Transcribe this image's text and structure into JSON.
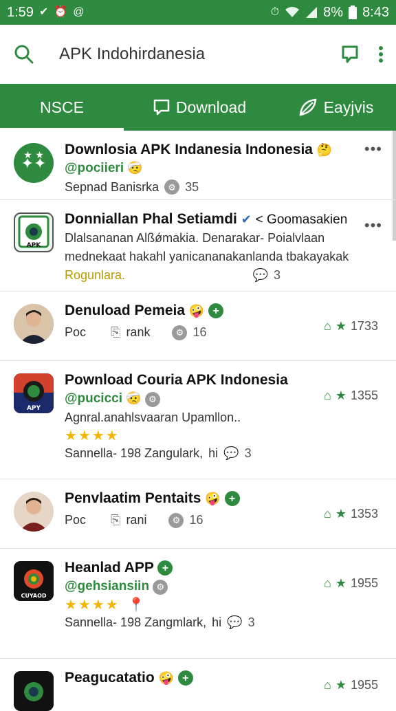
{
  "statusbar": {
    "time": "1:59",
    "right_time": "8:43",
    "battery_text": "8%",
    "left_icons": [
      "check-badge-icon",
      "alarm-icon",
      "at-icon"
    ],
    "right_icons": [
      "alarm-clock-icon",
      "wifi-icon",
      "signal-icon",
      "battery-icon"
    ]
  },
  "search": {
    "query": "APK Indohirdanesia"
  },
  "tabs": [
    {
      "label": "NSCE",
      "active": true
    },
    {
      "label": "Download",
      "active": false
    },
    {
      "label": "Eayjvis",
      "active": false
    }
  ],
  "items": [
    {
      "title": "Downlosia APK Indanesia Indonesia",
      "handle": "@pociieri",
      "meta": "Sepnad Banisrka",
      "count": "35"
    },
    {
      "title": "Donniallan Phal Setiamdi",
      "aside": "< Goomasakien",
      "desc1": "Dlalsananan Alßǿmakia. Denarakar- Poialvlaan",
      "desc2": "mednekaat hakahl yanicananakanlanda tbakayakak",
      "desc3": "Rogunlara.",
      "comments": "3"
    },
    {
      "title": "Denuload Pemeia",
      "meta_a": "Poc",
      "meta_b": "rank",
      "meta_c": "16",
      "rating": "1733"
    },
    {
      "title": "Pownload Couria APK Indonesia",
      "handle": "@pucicci",
      "desc": "Agnral.anahlsvaaran Upamllon..",
      "stars": "★★★★",
      "meta": "Sannella- 198 Zangulark,",
      "meta_b": "hi",
      "meta_c": "3",
      "rating": "1355"
    },
    {
      "title": "Penvlaatim Pentaits",
      "meta_a": "Poc",
      "meta_b": "rani",
      "meta_c": "16",
      "rating": "1353"
    },
    {
      "title": "Heanlad APP",
      "handle": "@gehsiansiin",
      "stars": "★★★★",
      "meta": "Sannella- 198 Zangmlark,",
      "meta_b": "hi",
      "meta_c": "3",
      "rating": "1955"
    },
    {
      "title": "Peagucatatio",
      "rating": "1955"
    }
  ]
}
